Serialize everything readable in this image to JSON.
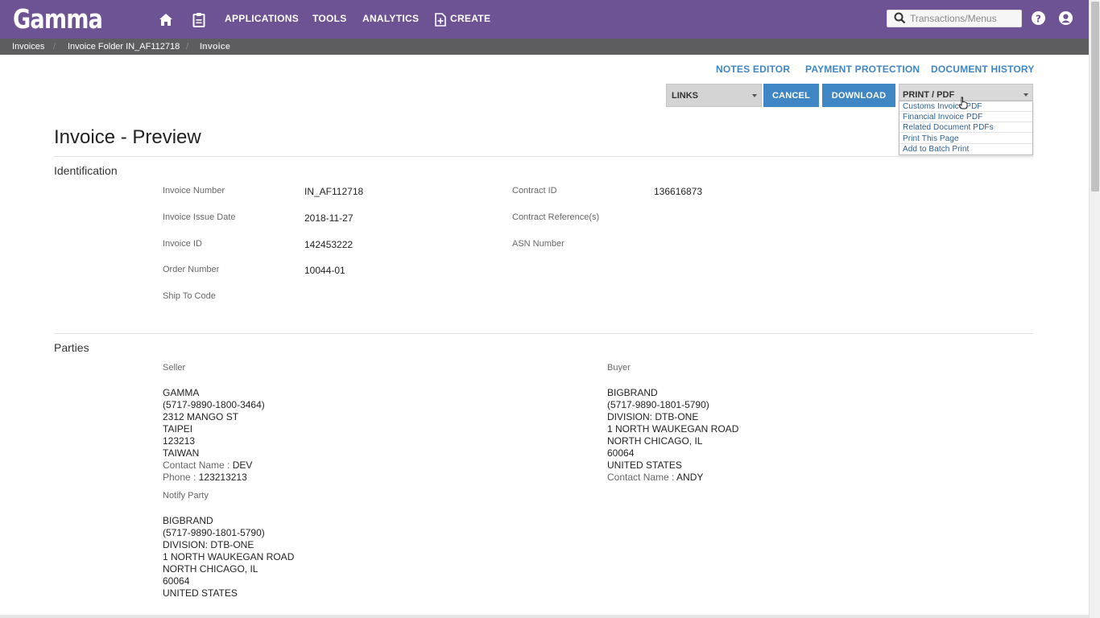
{
  "brand": {
    "name": "Gamma",
    "primary": "#6e5394",
    "accent": "#3f86c4"
  },
  "topnav": {
    "items": [
      "APPLICATIONS",
      "TOOLS",
      "ANALYTICS",
      "CREATE"
    ],
    "search_placeholder": "Transactions/Menus",
    "icons": [
      "home-icon",
      "clipboard-icon",
      "create-doc-icon",
      "search-icon",
      "help-icon",
      "user-icon"
    ]
  },
  "breadcrumb": [
    "Invoices",
    "Invoice Folder IN_AF112718",
    "Invoice"
  ],
  "actions": {
    "links": [
      "NOTES EDITOR",
      "PAYMENT PROTECTION",
      "DOCUMENT HISTORY"
    ],
    "links_select": "LINKS",
    "cancel": "CANCEL",
    "download": "DOWNLOAD",
    "print_select": "PRINT / PDF",
    "print_menu": [
      "Customs Invoice PDF",
      "Financial Invoice PDF",
      "Related Document PDFs",
      "Print This Page",
      "Add to Batch Print"
    ]
  },
  "page": {
    "title": "Invoice - Preview"
  },
  "identification": {
    "title": "Identification",
    "fields": [
      {
        "label": "Invoice Number",
        "value": "IN_AF112718"
      },
      {
        "label": "Invoice Issue Date",
        "value": "2018-11-27"
      },
      {
        "label": "Invoice ID",
        "value": "142453222"
      },
      {
        "label": "Order Number",
        "value": "10044-01"
      },
      {
        "label": "Ship To Code",
        "value": ""
      },
      {
        "label": "Contract ID",
        "value": "136616873"
      },
      {
        "label": "Contract Reference(s)",
        "value": ""
      },
      {
        "label": "ASN Number",
        "value": ""
      }
    ]
  },
  "parties": {
    "title": "Parties",
    "seller": {
      "label": "Seller",
      "lines": [
        "GAMMA",
        "(5717-9890-1800-3464)",
        "2312 MANGO ST",
        "TAIPEI",
        "123213",
        "TAIWAN"
      ],
      "contact_label": "Contact Name :",
      "contact": "DEV",
      "phone_label": "Phone :",
      "phone": "123213213"
    },
    "buyer": {
      "label": "Buyer",
      "lines": [
        "BIGBRAND",
        "(5717-9890-1801-5790)",
        "DIVISION: DTB-ONE",
        "1 NORTH WAUKEGAN ROAD",
        "NORTH CHICAGO, IL",
        "60064",
        "UNITED STATES"
      ],
      "contact_label": "Contact Name :",
      "contact": "ANDY"
    },
    "notify": {
      "label": "Notify Party",
      "lines": [
        "BIGBRAND",
        "(5717-9890-1801-5790)",
        "DIVISION: DTB-ONE",
        "1 NORTH WAUKEGAN ROAD",
        "NORTH CHICAGO, IL",
        "60064",
        "UNITED STATES"
      ]
    }
  }
}
